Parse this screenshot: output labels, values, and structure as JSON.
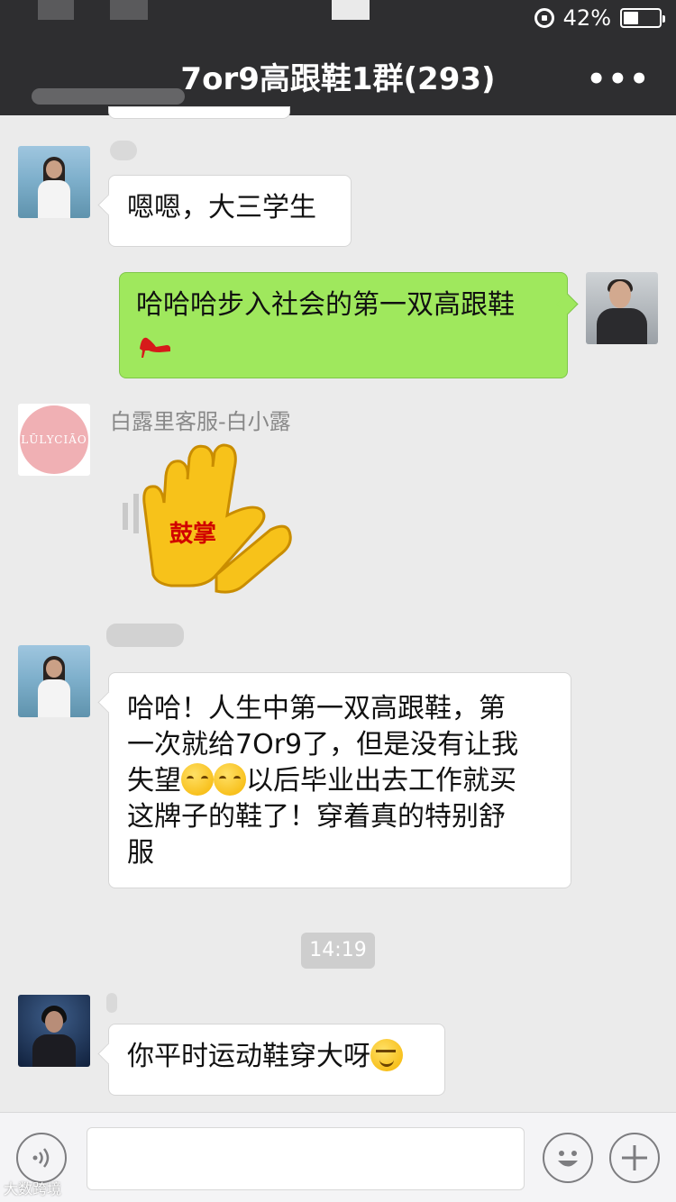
{
  "status_bar": {
    "battery": "42%",
    "battery_level": 0.42
  },
  "nav": {
    "title": "7or9高跟鞋1群(293)",
    "more": "•••"
  },
  "messages": {
    "m1": {
      "text": "嗯嗯，大三学生"
    },
    "m2": {
      "text": "哈哈哈步入社会的第一双高跟鞋"
    },
    "m3": {
      "sender": "白露里客服-白小露",
      "avatar_text": "LŪLYCIĀO",
      "sticker_text": "鼓掌"
    },
    "m4": {
      "line1": "哈哈！人生中第一双高跟鞋，第",
      "line2": "一次就给7Or9了，但是没有让我",
      "line3a": "失望",
      "line3b": "以后毕业出去工作就买",
      "line4": "这牌子的鞋了！穿着真的特别舒",
      "line5": "服"
    },
    "time": "14:19",
    "m5": {
      "text": "你平时运动鞋穿大呀"
    }
  },
  "icons": {
    "voice": "voice-icon",
    "emoji": "emoji-icon",
    "plus": "plus-icon",
    "more": "more-icon",
    "battery": "battery-icon",
    "rotation_lock": "rotation-lock-icon"
  },
  "watermark": "大数跨境",
  "colors": {
    "nav_bg": "#2e2e30",
    "bubble_self": "#9fe85d",
    "chat_bg": "#ebebeb"
  }
}
